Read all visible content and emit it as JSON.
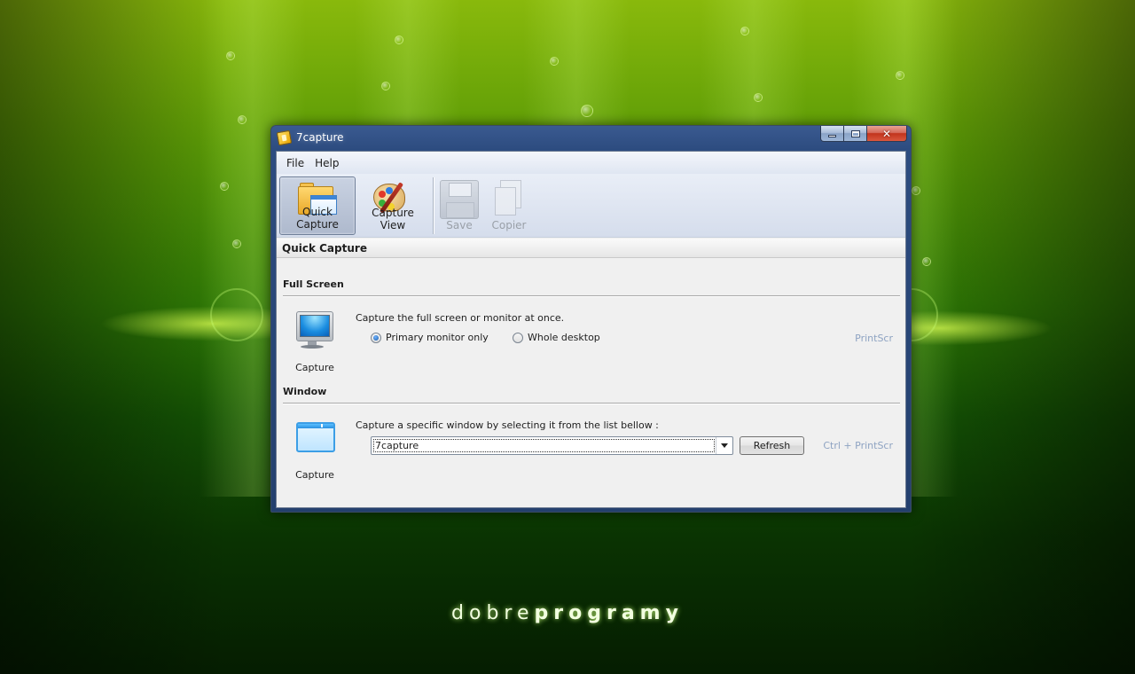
{
  "window": {
    "title": "7capture",
    "app_icon": "7capture-app-icon",
    "controls": {
      "minimize_icon": "minimize-icon",
      "maximize_icon": "maximize-icon",
      "close_icon": "close-icon"
    }
  },
  "menu": {
    "items": [
      "File",
      "Help"
    ]
  },
  "toolbar": {
    "quick_capture": {
      "label": "Quick Capture",
      "icon": "folder-window-icon",
      "active": true
    },
    "capture_view": {
      "label": "Capture View",
      "icon": "palette-icon"
    },
    "save": {
      "label": "Save",
      "icon": "floppy-disk-icon",
      "disabled": true
    },
    "copier": {
      "label": "Copier",
      "icon": "copy-icon",
      "disabled": true
    }
  },
  "section_title": "Quick Capture",
  "full_screen": {
    "heading": "Full Screen",
    "capture_label": "Capture",
    "capture_icon": "monitor-icon",
    "description": "Capture the full screen or monitor at once.",
    "options": [
      {
        "label": "Primary monitor only",
        "checked": true
      },
      {
        "label": "Whole desktop",
        "checked": false
      }
    ],
    "shortcut": "PrintScr"
  },
  "window_section": {
    "heading": "Window",
    "capture_label": "Capture",
    "capture_icon": "window-icon",
    "description": "Capture a specific window by selecting it from the list bellow :",
    "selected_window": "7capture",
    "refresh_label": "Refresh",
    "shortcut": "Ctrl + PrintScr"
  },
  "desktop": {
    "brand_light": "dobre",
    "brand_bold": "programy"
  },
  "colors": {
    "title_bar": "#2d4c80",
    "shortcut_text": "#8ea3c2",
    "client_bg": "#f0f0f0",
    "close_button": "#c2341c"
  }
}
